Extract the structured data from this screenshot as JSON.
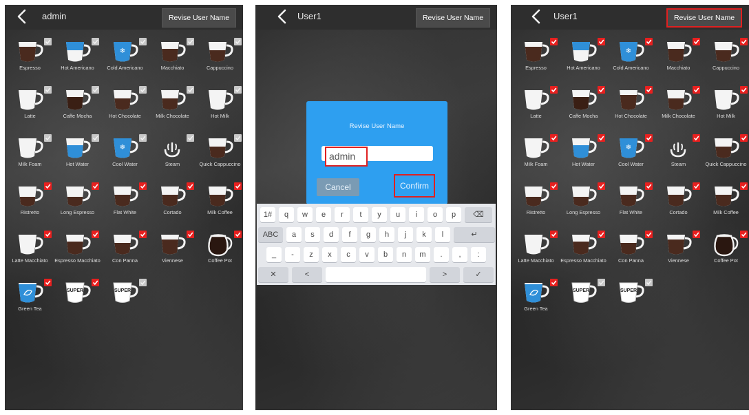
{
  "screens": [
    {
      "id": "s1",
      "title": "admin",
      "revise_label": "Revise User Name",
      "items": [
        {
          "label": "Espresso",
          "icon": "espresso-cup-icon",
          "fill": "dark",
          "checked": false,
          "red": false
        },
        {
          "label": "Hot Americano",
          "icon": "hot-americano-cup-icon",
          "fill": "blue",
          "checked": false,
          "red": false
        },
        {
          "label": "Cold Americano",
          "icon": "cold-americano-cup-icon",
          "fill": "blue-snow",
          "checked": false,
          "red": false
        },
        {
          "label": "Macchiato",
          "icon": "macchiato-cup-icon",
          "fill": "foam-dark",
          "checked": false,
          "red": false
        },
        {
          "label": "Cappuccino",
          "icon": "cappuccino-cup-icon",
          "fill": "foam-top",
          "checked": false,
          "red": false
        },
        {
          "label": "Latte",
          "icon": "latte-cup-icon",
          "fill": "white",
          "checked": false,
          "red": false
        },
        {
          "label": "Caffe Mocha",
          "icon": "caffe-mocha-cup-icon",
          "fill": "mocha",
          "checked": false,
          "red": false
        },
        {
          "label": "Hot Chocolate",
          "icon": "hot-chocolate-cup-icon",
          "fill": "white-dark",
          "checked": false,
          "red": false
        },
        {
          "label": "Milk Chocolate",
          "icon": "milk-chocolate-cup-icon",
          "fill": "white-dark",
          "checked": false,
          "red": false
        },
        {
          "label": "Hot Milk",
          "icon": "hot-milk-cup-icon",
          "fill": "white",
          "checked": false,
          "red": false
        },
        {
          "label": "Milk Foam",
          "icon": "milk-foam-cup-icon",
          "fill": "foam-white",
          "checked": false,
          "red": false
        },
        {
          "label": "Hot Water",
          "icon": "hot-water-cup-icon",
          "fill": "blue-low",
          "checked": false,
          "red": false
        },
        {
          "label": "Cool Water",
          "icon": "cool-water-cup-icon",
          "fill": "blue-snow",
          "checked": false,
          "red": false
        },
        {
          "label": "Steam",
          "icon": "steam-icon",
          "fill": "steam",
          "checked": false,
          "red": false
        },
        {
          "label": "Quick Cappuccino",
          "icon": "quick-cappuccino-cup-icon",
          "fill": "foam-top",
          "checked": false,
          "red": false
        },
        {
          "label": "Ristretto",
          "icon": "ristretto-cup-icon",
          "fill": "dark-low",
          "checked": true,
          "red": false
        },
        {
          "label": "Long Espresso",
          "icon": "long-espresso-cup-icon",
          "fill": "dark-low",
          "checked": true,
          "red": false
        },
        {
          "label": "Flat White",
          "icon": "flat-white-cup-icon",
          "fill": "white-dark",
          "checked": true,
          "red": false
        },
        {
          "label": "Cortado",
          "icon": "cortado-cup-icon",
          "fill": "white-dark",
          "checked": true,
          "red": false
        },
        {
          "label": "Milk Coffee",
          "icon": "milk-coffee-cup-icon",
          "fill": "white-dark",
          "checked": true,
          "red": false
        },
        {
          "label": "Latte Macchiato",
          "icon": "latte-macchiato-cup-icon",
          "fill": "foam-white",
          "checked": true,
          "red": false
        },
        {
          "label": "Espresso Macchiato",
          "icon": "espresso-macchiato-cup-icon",
          "fill": "foam-dark",
          "checked": true,
          "red": false
        },
        {
          "label": "Con Panna",
          "icon": "con-panna-cup-icon",
          "fill": "white-dark",
          "checked": true,
          "red": false
        },
        {
          "label": "Viennese",
          "icon": "viennese-cup-icon",
          "fill": "dark",
          "checked": true,
          "red": false
        },
        {
          "label": "Coffee Pot",
          "icon": "coffee-pot-icon",
          "fill": "pot",
          "checked": true,
          "red": false
        },
        {
          "label": "Green Tea",
          "icon": "green-tea-cup-icon",
          "fill": "tea",
          "checked": true,
          "red": false
        },
        {
          "label": " ",
          "icon": "super-cup-icon",
          "fill": "super",
          "checked": true,
          "red": true
        },
        {
          "label": " ",
          "icon": "super-cup-icon",
          "fill": "super",
          "checked": false,
          "red": true
        }
      ]
    },
    {
      "id": "s2",
      "title": "User1",
      "revise_label": "Revise User Name",
      "dialog": {
        "title": "Revise User Name",
        "input_value": "admin",
        "cancel": "Cancel",
        "confirm": "Confirm"
      },
      "keyboard": {
        "row1": [
          "1#",
          "q",
          "w",
          "e",
          "r",
          "t",
          "y",
          "u",
          "i",
          "o",
          "p",
          "⌫"
        ],
        "row2": [
          "ABC",
          "a",
          "s",
          "d",
          "f",
          "g",
          "h",
          "j",
          "k",
          "l",
          "↵"
        ],
        "row3": [
          "_",
          "-",
          "z",
          "x",
          "c",
          "v",
          "b",
          "n",
          "m",
          ".",
          ",",
          ":"
        ],
        "row4": [
          "✕",
          "<",
          " ",
          ">",
          "✓"
        ]
      }
    },
    {
      "id": "s3",
      "title": "User1",
      "revise_label": "Revise User Name",
      "items": [
        {
          "label": "Espresso",
          "icon": "espresso-cup-icon",
          "fill": "dark",
          "checked": true,
          "red": false
        },
        {
          "label": "Hot Americano",
          "icon": "hot-americano-cup-icon",
          "fill": "blue",
          "checked": true,
          "red": false
        },
        {
          "label": "Cold Americano",
          "icon": "cold-americano-cup-icon",
          "fill": "blue-snow",
          "checked": true,
          "red": false
        },
        {
          "label": "Macchiato",
          "icon": "macchiato-cup-icon",
          "fill": "foam-dark",
          "checked": true,
          "red": false
        },
        {
          "label": "Cappuccino",
          "icon": "cappuccino-cup-icon",
          "fill": "foam-top",
          "checked": true,
          "red": false
        },
        {
          "label": "Latte",
          "icon": "latte-cup-icon",
          "fill": "white",
          "checked": true,
          "red": false
        },
        {
          "label": "Caffe Mocha",
          "icon": "caffe-mocha-cup-icon",
          "fill": "mocha",
          "checked": true,
          "red": false
        },
        {
          "label": "Hot Chocolate",
          "icon": "hot-chocolate-cup-icon",
          "fill": "dark",
          "checked": true,
          "red": false
        },
        {
          "label": "Milk Chocolate",
          "icon": "milk-chocolate-cup-icon",
          "fill": "white-dark",
          "checked": true,
          "red": false
        },
        {
          "label": "Hot Milk",
          "icon": "hot-milk-cup-icon",
          "fill": "white",
          "checked": true,
          "red": false
        },
        {
          "label": "Milk Foam",
          "icon": "milk-foam-cup-icon",
          "fill": "foam-white",
          "checked": true,
          "red": false
        },
        {
          "label": "Hot Water",
          "icon": "hot-water-cup-icon",
          "fill": "blue-low",
          "checked": true,
          "red": false
        },
        {
          "label": "Cool Water",
          "icon": "cool-water-cup-icon",
          "fill": "blue-snow",
          "checked": true,
          "red": false
        },
        {
          "label": "Steam",
          "icon": "steam-icon",
          "fill": "steam",
          "checked": true,
          "red": false
        },
        {
          "label": "Quick Cappuccino",
          "icon": "quick-cappuccino-cup-icon",
          "fill": "foam-top",
          "checked": true,
          "red": false
        },
        {
          "label": "Ristretto",
          "icon": "ristretto-cup-icon",
          "fill": "dark-low",
          "checked": true,
          "red": false
        },
        {
          "label": "Long Espresso",
          "icon": "long-espresso-cup-icon",
          "fill": "dark-low",
          "checked": true,
          "red": false
        },
        {
          "label": "Flat White",
          "icon": "flat-white-cup-icon",
          "fill": "white-dark",
          "checked": true,
          "red": false
        },
        {
          "label": "Cortado",
          "icon": "cortado-cup-icon",
          "fill": "white-dark",
          "checked": true,
          "red": false
        },
        {
          "label": "Milk Coffee",
          "icon": "milk-coffee-cup-icon",
          "fill": "white-dark",
          "checked": true,
          "red": false
        },
        {
          "label": "Latte Macchiato",
          "icon": "latte-macchiato-cup-icon",
          "fill": "foam-white",
          "checked": true,
          "red": false
        },
        {
          "label": "Espresso Macchiato",
          "icon": "espresso-macchiato-cup-icon",
          "fill": "foam-dark",
          "checked": true,
          "red": false
        },
        {
          "label": "Con Panna",
          "icon": "con-panna-cup-icon",
          "fill": "white-dark",
          "checked": true,
          "red": false
        },
        {
          "label": "Viennese",
          "icon": "viennese-cup-icon",
          "fill": "dark",
          "checked": true,
          "red": false
        },
        {
          "label": "Coffee Pot",
          "icon": "coffee-pot-icon",
          "fill": "pot",
          "checked": true,
          "red": false
        },
        {
          "label": "Green Tea",
          "icon": "green-tea-cup-icon",
          "fill": "tea",
          "checked": true,
          "red": false
        },
        {
          "label": " ",
          "icon": "super-cup-icon",
          "fill": "super",
          "checked": false,
          "red": true
        },
        {
          "label": " ",
          "icon": "super-cup-icon",
          "fill": "super",
          "checked": false,
          "red": true
        }
      ]
    }
  ],
  "colors": {
    "check_on": "#e8201f",
    "check_off": "#c8c8c8",
    "dialog_blue": "#2e9ff0",
    "coffee": "#4a2a1e",
    "water_blue": "#2f8fd8",
    "highlight_red": "#e02020"
  }
}
